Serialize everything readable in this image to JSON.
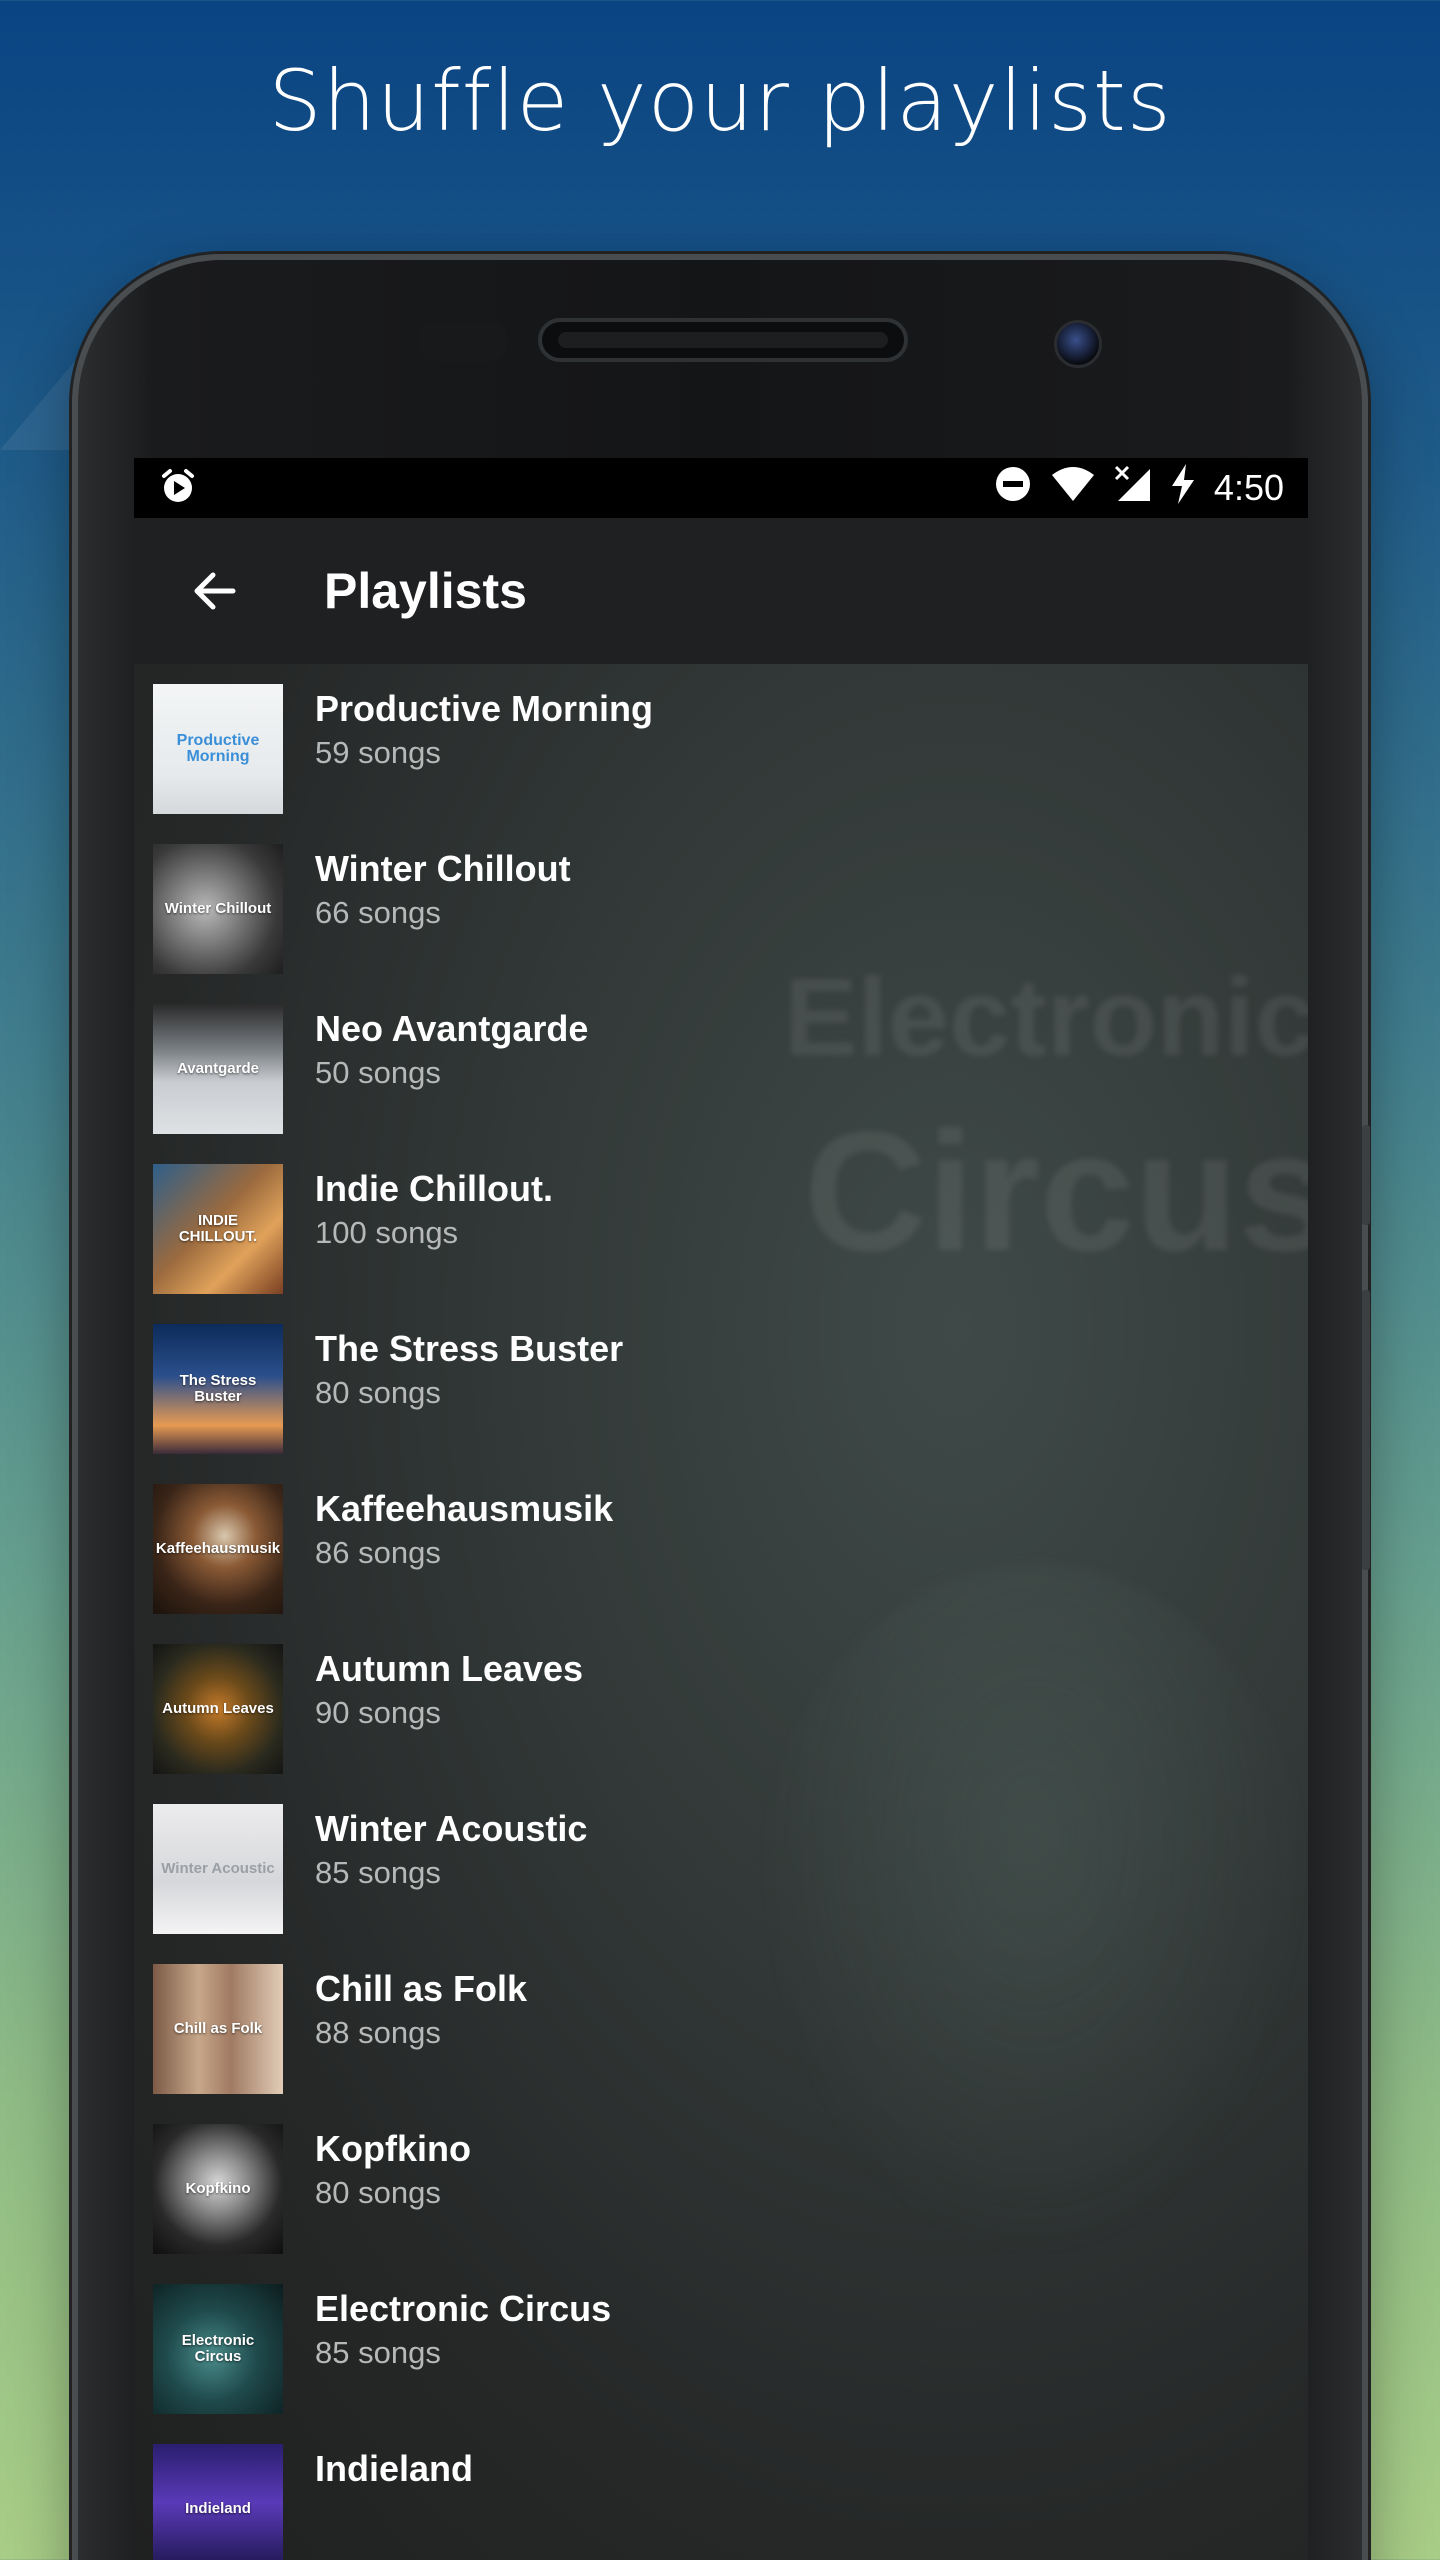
{
  "headline": "Shuffle your playlists",
  "status_bar": {
    "time": "4:50",
    "icons": [
      "alarm-icon",
      "do-not-disturb-icon",
      "wifi-icon",
      "no-signal-icon",
      "charging-icon"
    ]
  },
  "app_bar": {
    "back_icon": "arrow-back-icon",
    "title": "Playlists"
  },
  "background_artwork": {
    "line1": "Electronic",
    "line2": "Circus"
  },
  "playlists": [
    {
      "title": "Productive Morning",
      "subtitle": "59 songs",
      "art_text": "Productive Morning"
    },
    {
      "title": "Winter Chillout",
      "subtitle": "66 songs",
      "art_text": "Winter Chillout"
    },
    {
      "title": "Neo Avantgarde",
      "subtitle": "50 songs",
      "art_text": "Avantgarde"
    },
    {
      "title": "Indie Chillout.",
      "subtitle": "100 songs",
      "art_text": "INDIE CHILLOUT."
    },
    {
      "title": "The Stress Buster",
      "subtitle": "80 songs",
      "art_text": "The Stress Buster"
    },
    {
      "title": "Kaffeehausmusik",
      "subtitle": "86 songs",
      "art_text": "Kaffeehausmusik"
    },
    {
      "title": "Autumn Leaves",
      "subtitle": "90 songs",
      "art_text": "Autumn Leaves"
    },
    {
      "title": "Winter Acoustic",
      "subtitle": "85 songs",
      "art_text": "Winter Acoustic"
    },
    {
      "title": "Chill as Folk",
      "subtitle": "88 songs",
      "art_text": "Chill as Folk"
    },
    {
      "title": "Kopfkino",
      "subtitle": "80 songs",
      "art_text": "Kopfkino"
    },
    {
      "title": "Electronic Circus",
      "subtitle": "85 songs",
      "art_text": "Electronic Circus"
    },
    {
      "title": "Indieland",
      "subtitle": "",
      "art_text": "Indieland"
    }
  ],
  "colors": {
    "status_bar": "#000000",
    "app_bar": "#1f2021",
    "title_text": "#ffffff",
    "subtitle_text": "#b7b9b9"
  }
}
